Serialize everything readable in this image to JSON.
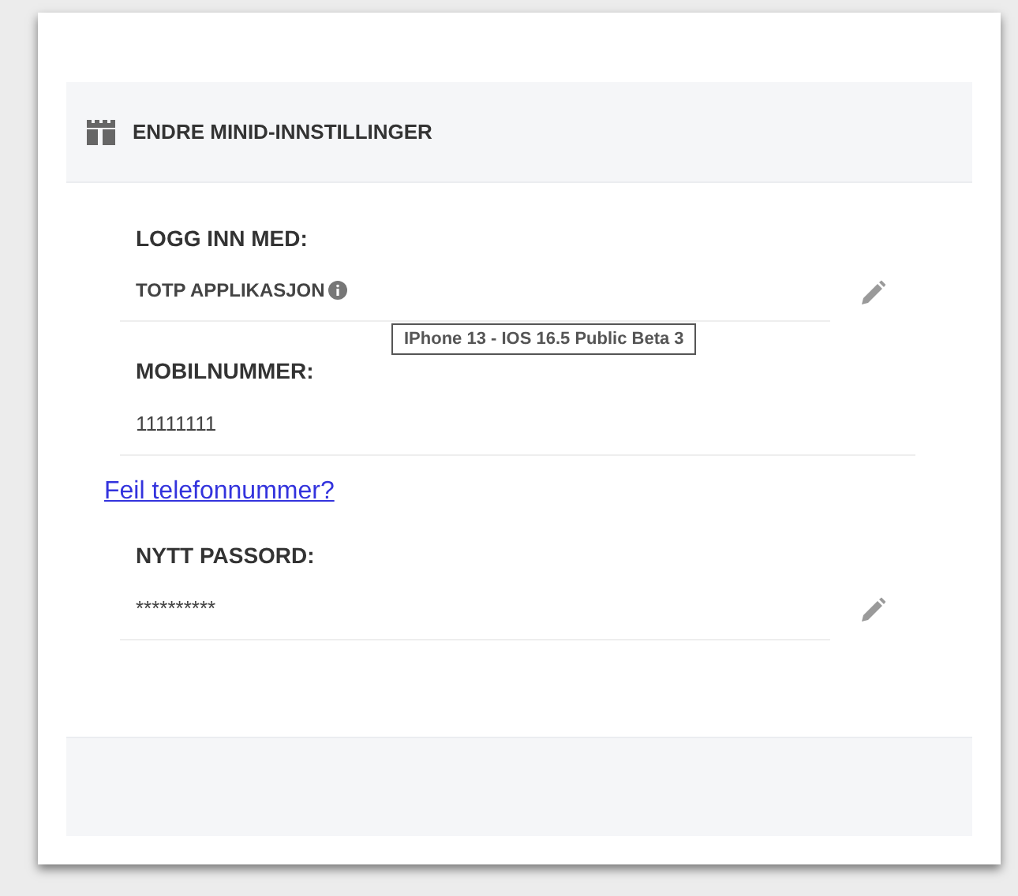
{
  "header": {
    "title": "ENDRE MINID-INNSTILLINGER"
  },
  "sections": [
    {
      "kind": "editable",
      "label": "LOGG INN MED:",
      "value": "TOTP APPLIKASJON",
      "tooltip": "IPhone 13 - IOS 16.5 Public Beta 3"
    },
    {
      "kind": "plain",
      "label": "MOBILNUMMER:",
      "value": "11111111",
      "link": "Feil telefonnummer?"
    },
    {
      "kind": "editable",
      "label": "NYTT PASSORD:",
      "value": "**********"
    }
  ]
}
